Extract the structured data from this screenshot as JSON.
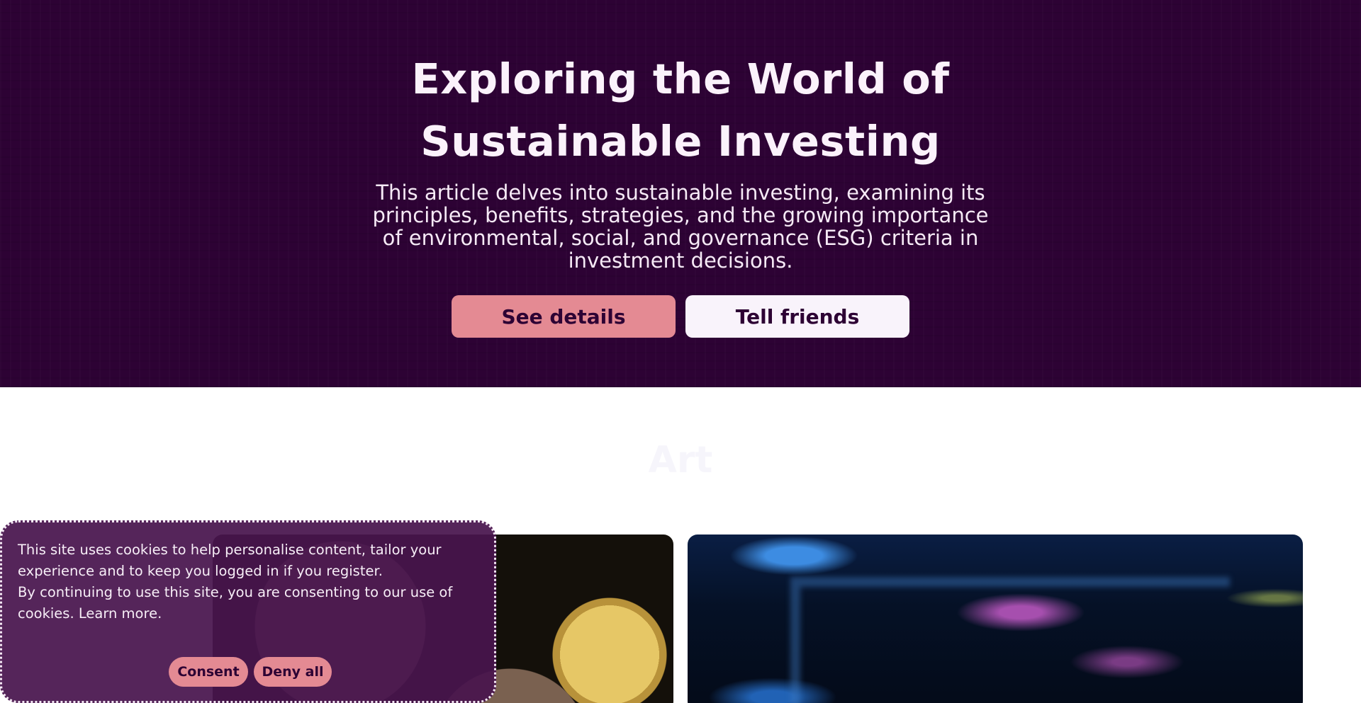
{
  "hero": {
    "title_line1": "Exploring the World of",
    "title_line2": "Sustainable Investing",
    "description": "This article delves into sustainable investing, examining its principles, benefits, strategies, and the growing importance of environmental, social, and governance (ESG) criteria in investment decisions.",
    "primary_button": "See details",
    "secondary_button": "Tell friends"
  },
  "section": {
    "title": "Art"
  },
  "cookie_banner": {
    "line1": "This site uses cookies to help personalise content, tailor your experience and to keep you logged in if you register.",
    "line2": "By continuing to use this site, you are consenting to our use of cookies.",
    "learn_more": "Learn more.",
    "consent_button": "Consent",
    "deny_button": "Deny all"
  },
  "colors": {
    "hero_background": "#2d0234",
    "accent": "#e48a93",
    "secondary_button": "#f9f3fb",
    "cookie_background": "#48144e"
  }
}
